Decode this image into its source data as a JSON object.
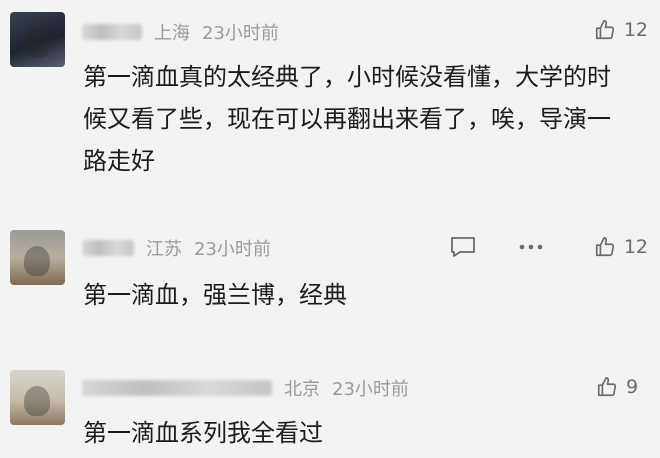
{
  "comments": [
    {
      "location": "上海",
      "time": "23小时前",
      "text": "第一滴血真的太经典了，小时候没看懂，大学的时候又看了些，现在可以再翻出来看了，唉，导演一路走好",
      "likes": "12",
      "show_reply_more": false
    },
    {
      "location": "江苏",
      "time": "23小时前",
      "text": "第一滴血，强兰博，经典",
      "likes": "12",
      "show_reply_more": true
    },
    {
      "location": "北京",
      "time": "23小时前",
      "text": "第一滴血系列我全看过",
      "likes": "9",
      "show_reply_more": false
    }
  ],
  "icons": {
    "like": "thumbs-up-icon",
    "reply": "comment-bubble-icon",
    "more": "more-dots-icon"
  },
  "colors": {
    "background": "#f3f3f3",
    "text": "#1b1b1b",
    "meta": "#9a9a9a",
    "icon": "#6a6a6a"
  }
}
